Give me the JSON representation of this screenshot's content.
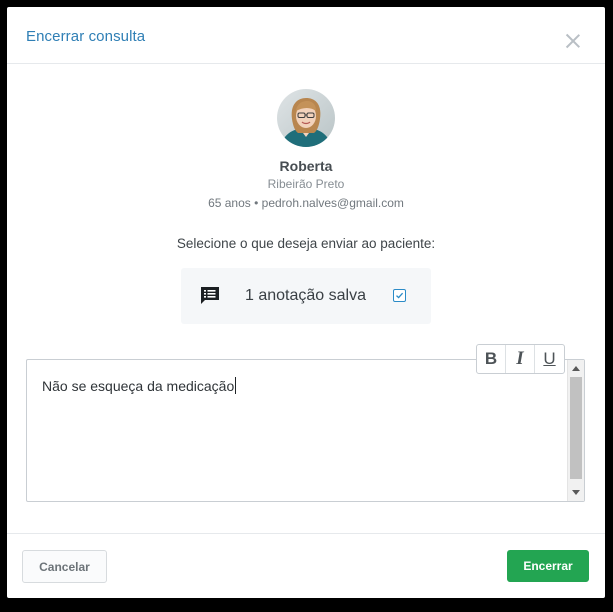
{
  "modal": {
    "title": "Encerrar consulta",
    "close_icon": "close-icon"
  },
  "patient": {
    "name": "Roberta",
    "city": "Ribeirão Preto",
    "meta": "65 anos • pedroh.nalves@gmail.com",
    "avatar_icon": "patient-photo"
  },
  "send": {
    "prompt": "Selecione o que deseja enviar ao paciente:",
    "note_icon": "note-icon",
    "note_label": "1 anotação salva",
    "note_checked": true
  },
  "editor": {
    "value": "Não se esqueça da medicação",
    "toolbar": {
      "bold": "B",
      "italic": "I",
      "underline": "U"
    }
  },
  "footer": {
    "cancel_label": "Cancelar",
    "confirm_label": "Encerrar"
  },
  "colors": {
    "title": "#2f7fb5",
    "primary_button": "#23a552",
    "checkbox": "#2b8bc7"
  }
}
